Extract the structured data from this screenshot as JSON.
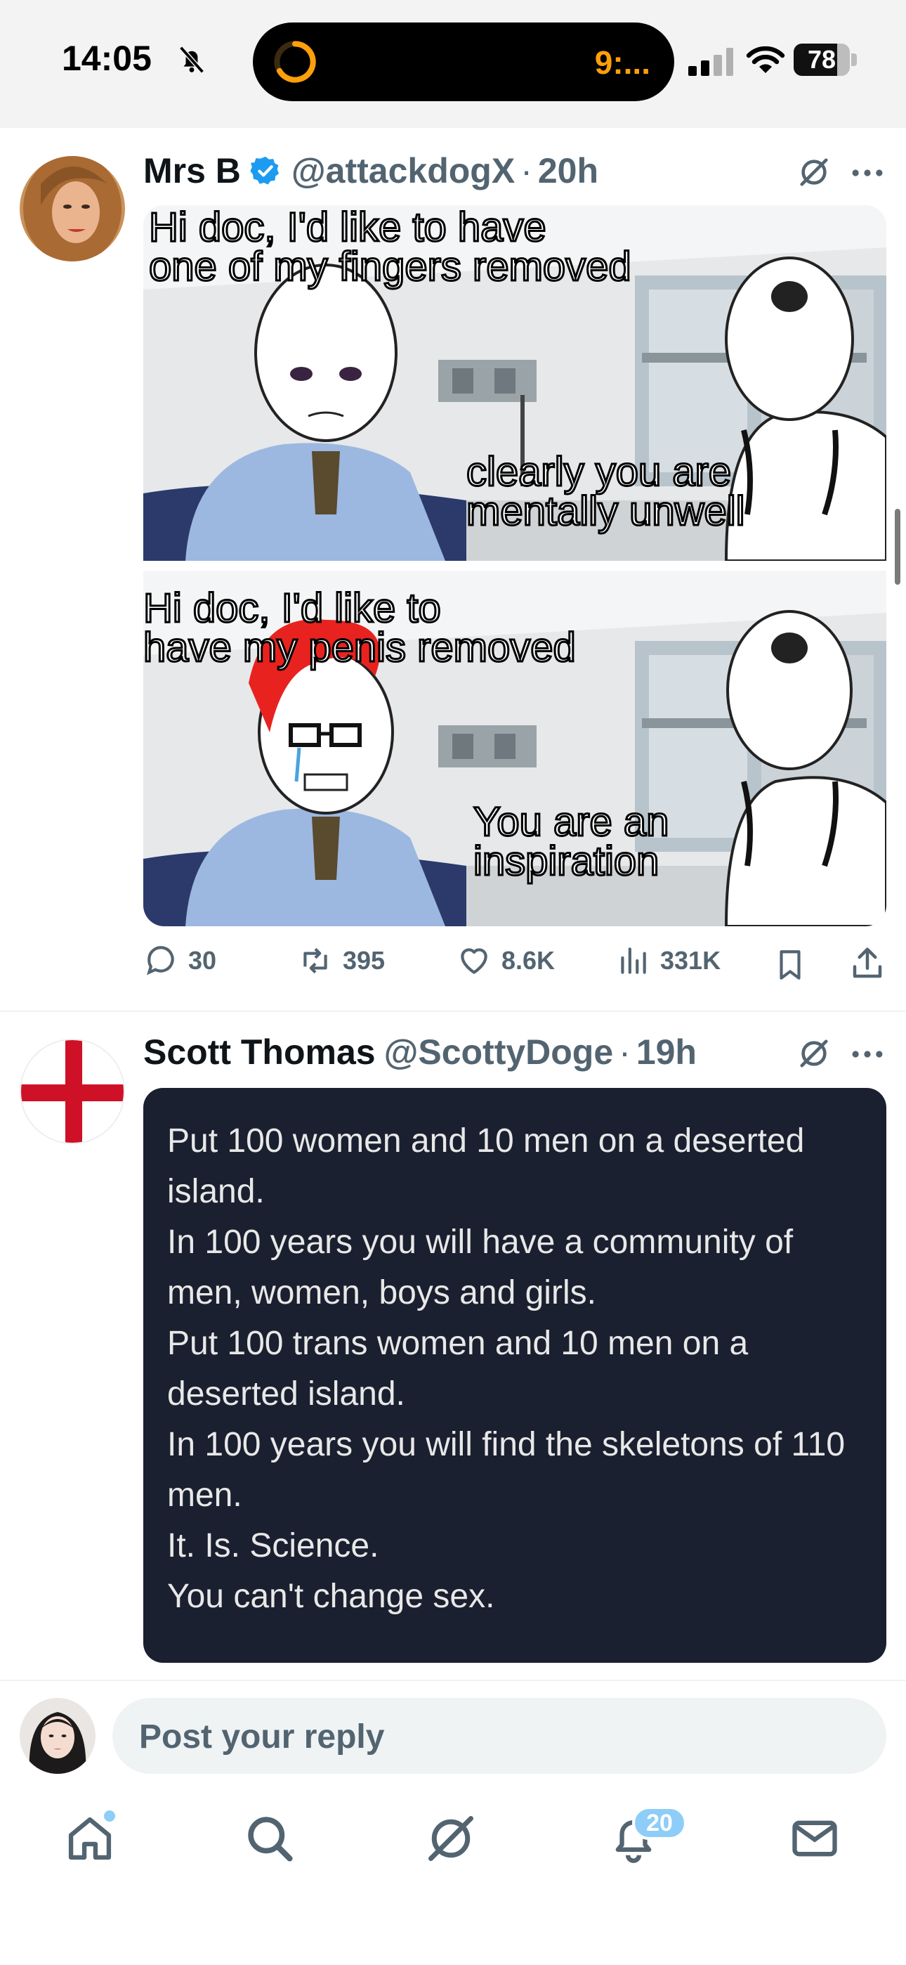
{
  "status_bar": {
    "time": "14:05",
    "activity_text": "9:...",
    "battery": "78",
    "battery_fraction": 0.78,
    "icons": [
      "bell-slash-icon",
      "progress-ring-icon",
      "cellular-signal-icon",
      "wifi-icon",
      "battery-icon"
    ]
  },
  "posts": [
    {
      "name": "Mrs B",
      "verified": true,
      "handle": "@attackdogX",
      "separator": "·",
      "time": "20h",
      "meme": {
        "panel1_top": "Hi doc, I'd like to have\none of my fingers removed",
        "panel1_bottom": "clearly you are\nmentally unwell",
        "panel2_top": "Hi doc, I'd like to\nhave my penis removed",
        "panel2_bottom": "You are an\ninspiration"
      },
      "actions": {
        "replies": "30",
        "reposts": "395",
        "likes": "8.6K",
        "views": "331K"
      }
    },
    {
      "name": "Scott Thomas",
      "handle": "@ScottyDoge",
      "separator": "·",
      "time": "19h",
      "image_text": "Put 100 women and 10 men on a deserted island.\nIn 100 years you will have a community of men, women, boys and girls.\nPut 100 trans women and 10 men on a deserted island.\nIn 100 years you will find the skeletons of 110 men.\nIt. Is. Science.\nYou can't change sex."
    }
  ],
  "reply": {
    "placeholder": "Post your reply"
  },
  "tabbar": {
    "notifications_badge": "20",
    "tabs": [
      "home-icon",
      "search-icon",
      "grok-icon",
      "notifications-icon",
      "messages-icon"
    ]
  },
  "colors": {
    "accent": "#1d9bf0",
    "badge": "#8ecdf8",
    "muted_text": "#536471",
    "card_bg": "#1b2030"
  }
}
